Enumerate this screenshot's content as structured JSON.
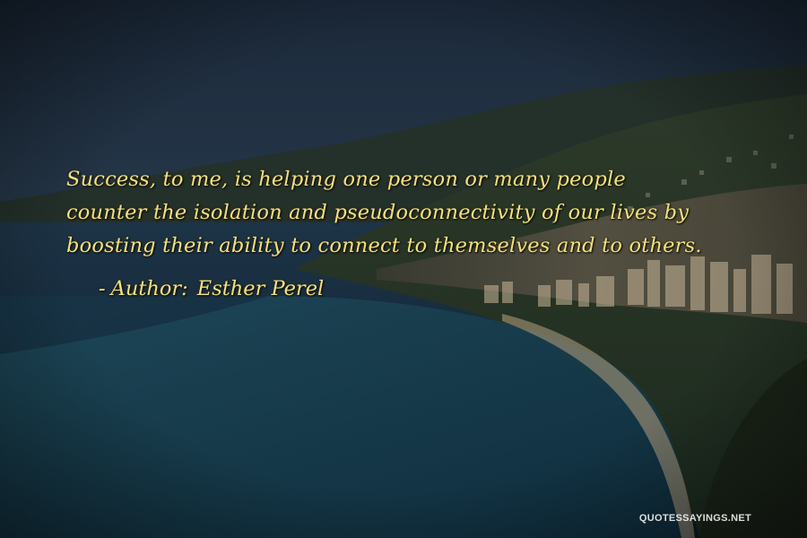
{
  "quote": {
    "lines": [
      "Success, to me, is helping one person or many people",
      "counter the isolation and pseudoconnectivity of our lives by",
      "boosting their ability to connect to themselves and to others."
    ],
    "attribution_prefix": "-",
    "attribution_label": "Author:",
    "author": "Esther Perel"
  },
  "watermark": "QUOTESSAYINGS.NET",
  "colors": {
    "quote_text": "#f2e082",
    "sky_top": "#1b2a3a",
    "sea_deep": "#0d2233",
    "watermark": "#ffffff"
  }
}
